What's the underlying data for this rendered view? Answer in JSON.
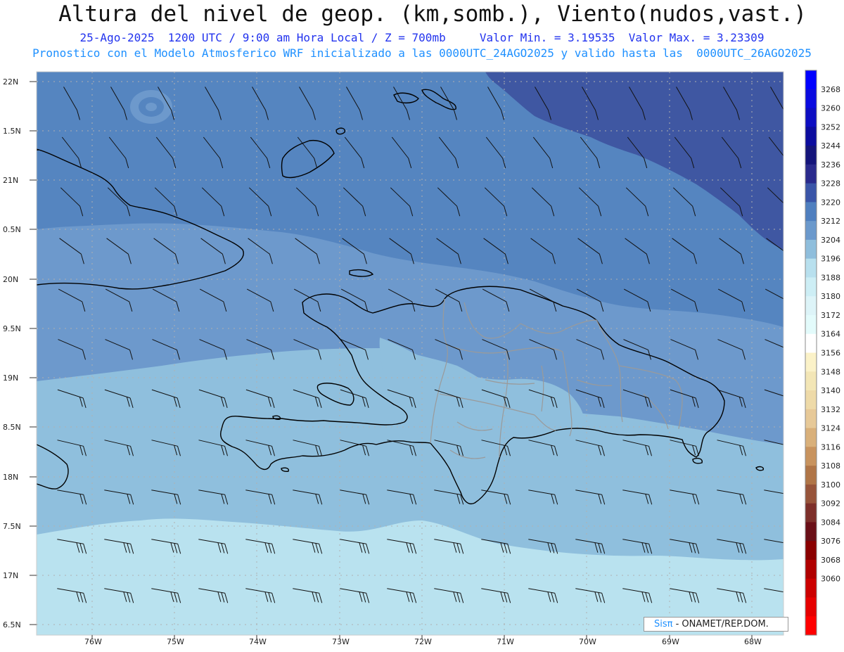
{
  "title": "Altura del nivel de geop. (km,somb.), Viento(nudos,vast.)",
  "subtitle_line1": "25-Ago-2025  1200 UTC / 9:00 am Hora Local / Z = 700mb     Valor Min. = 3.19535  Valor Max. = 3.23309",
  "subtitle_line2": "Pronostico con el Modelo Atmosferico WRF inicializado a las 0000UTC_24AGO2025 y valido hasta las  0000UTC_26AGO2025",
  "lat_labels": [
    "22N",
    "1.5N",
    "21N",
    "0.5N",
    "20N",
    "9.5N",
    "19N",
    "8.5N",
    "18N",
    "7.5N",
    "17N",
    "6.5N"
  ],
  "lon_labels": [
    "76W",
    "75W",
    "74W",
    "73W",
    "72W",
    "71W",
    "70W",
    "69W",
    "68W"
  ],
  "colorbar": {
    "labels": [
      "3268",
      "3260",
      "3252",
      "3244",
      "3236",
      "3228",
      "3220",
      "3212",
      "3204",
      "3196",
      "3188",
      "3180",
      "3172",
      "3164",
      "3156",
      "3148",
      "3140",
      "3132",
      "3124",
      "3116",
      "3108",
      "3100",
      "3092",
      "3084",
      "3076",
      "3068",
      "3060"
    ],
    "colors": [
      "#0000ff",
      "#0a0ae0",
      "#0d0dc2",
      "#0c0c9e",
      "#14147a",
      "#2a2a8c",
      "#3a55a8",
      "#4f7fbf",
      "#6b99cc",
      "#8fbedc",
      "#b8e0ee",
      "#cdeef5",
      "#ddf4f8",
      "#e3fbfb",
      "#ffffff",
      "#fbf2c8",
      "#f3e6b6",
      "#eedaa8",
      "#e7c998",
      "#d9b07a",
      "#c8935e",
      "#b07547",
      "#97543a",
      "#7d2f2a",
      "#6a0f17",
      "#8a0000",
      "#b00000",
      "#cc0000",
      "#e60000",
      "#ff0000"
    ]
  },
  "credit": {
    "brand": "Sisπ",
    "text": " - ONAMET/REP.DOM."
  },
  "colors": {
    "title": "#111111",
    "subtitle1": "#2233ee",
    "subtitle2": "#1e90ff"
  }
}
